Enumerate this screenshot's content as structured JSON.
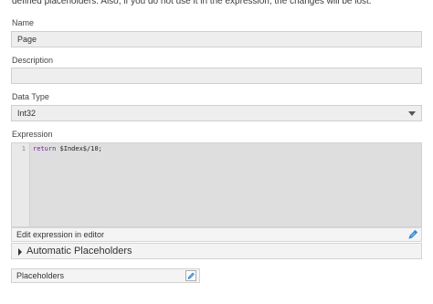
{
  "top_note": "defined placeholders. Also, if you do not use it in the expression, the changes will be lost.",
  "name": {
    "label": "Name",
    "value": "Page"
  },
  "description": {
    "label": "Description",
    "value": ""
  },
  "data_type": {
    "label": "Data Type",
    "value": "Int32"
  },
  "expression": {
    "label": "Expression",
    "line_number": "1",
    "keyword": "return",
    "code": " $Index$/10;"
  },
  "edit_expression_label": "Edit expression in editor",
  "automatic_placeholders_label": "Automatic Placeholders",
  "placeholders_label": "Placeholders",
  "colors": {
    "field_bg": "#eeeeee",
    "code_bg": "#dedede",
    "keyword": "#7a1fa0",
    "pencil_blue": "#2a7fd4"
  }
}
